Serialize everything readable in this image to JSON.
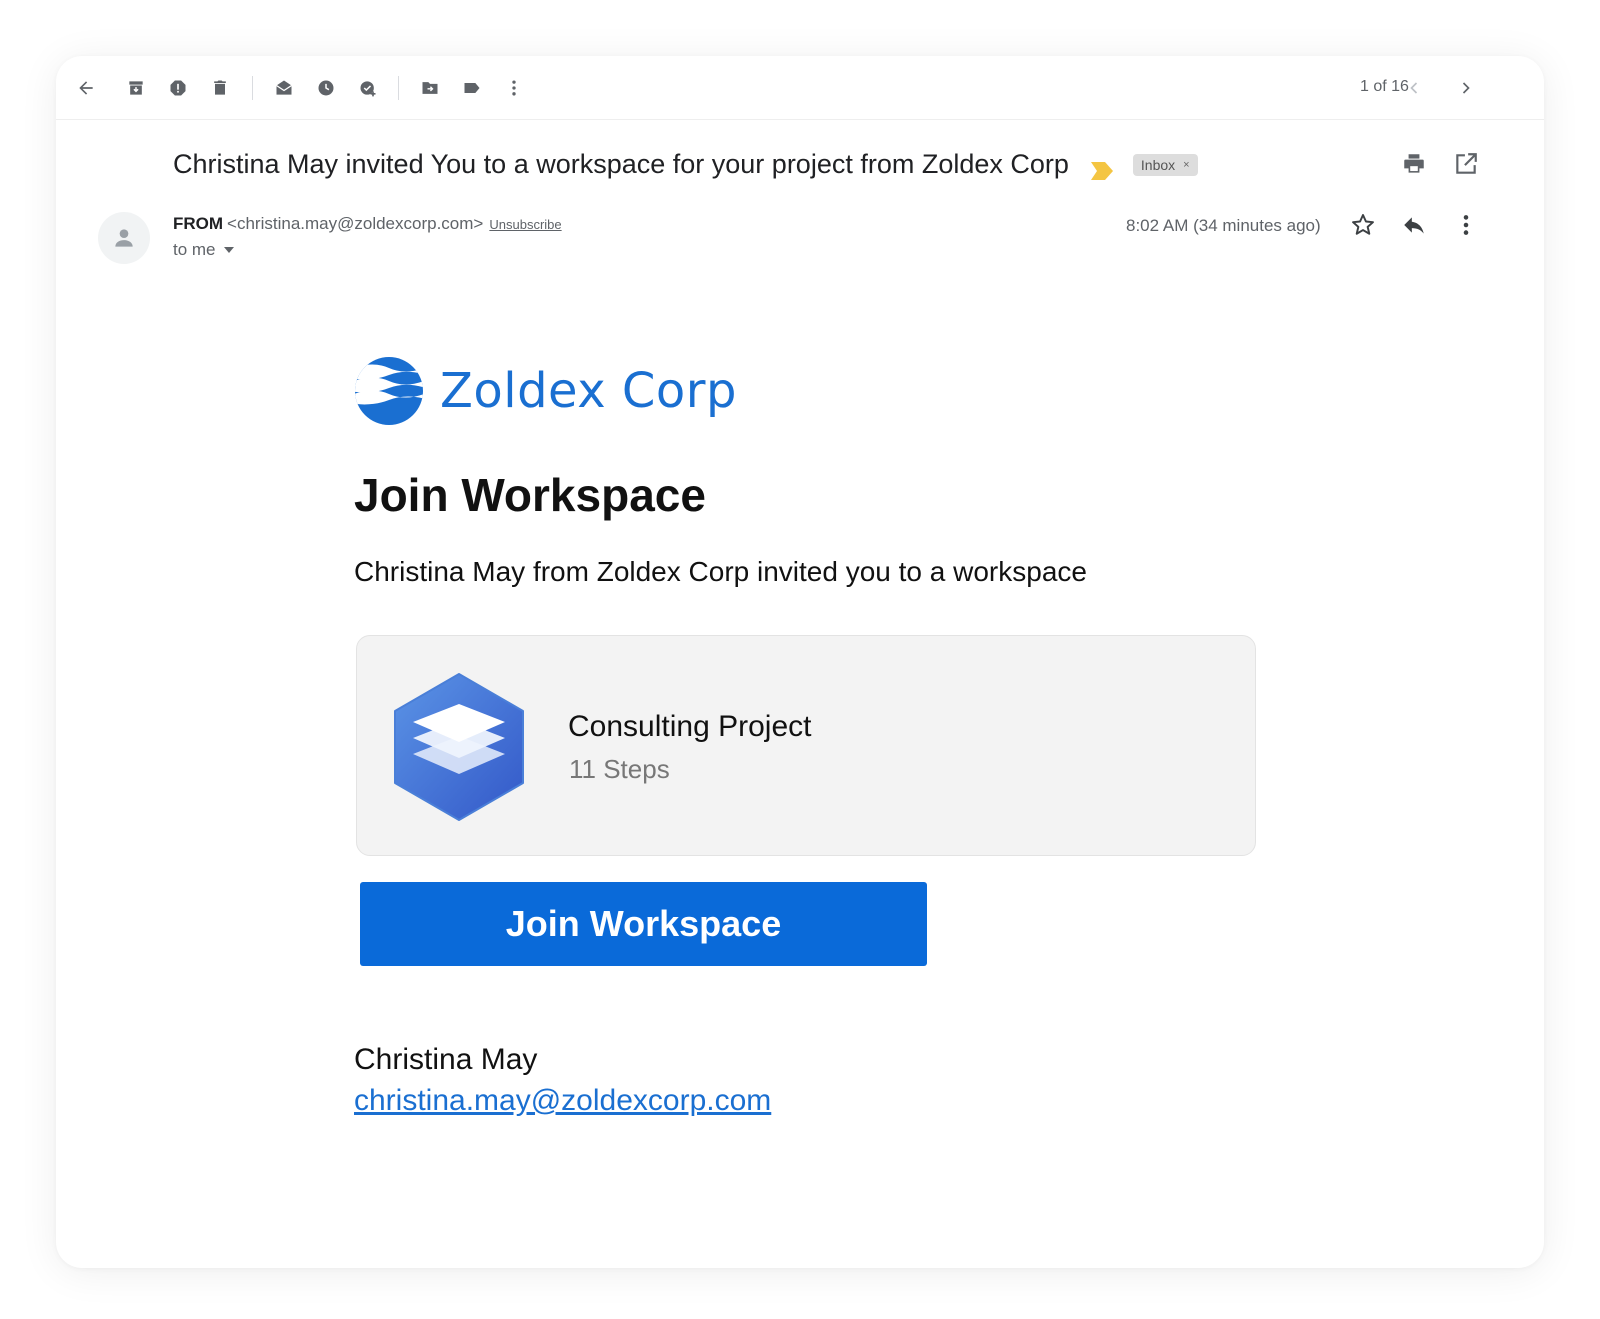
{
  "toolbar": {
    "icons": [
      "back-arrow-icon",
      "archive-icon",
      "report-spam-icon",
      "delete-icon",
      "mark-unread-icon",
      "snooze-icon",
      "add-task-icon",
      "move-to-icon",
      "label-icon",
      "more-vert-icon"
    ],
    "pager_text": "1 of 16"
  },
  "message": {
    "subject": "Christina May invited You to a workspace for your project from Zoldex Corp",
    "label_chip": "Inbox",
    "label_chip_close": "×",
    "sender_name": "FROM",
    "sender_email": "<christina.may@zoldexcorp.com>",
    "unsubscribe": "Unsubscribe",
    "to_me": "to me",
    "timestamp": "8:02 AM (34 minutes ago)"
  },
  "email_body": {
    "brand_name": "Zoldex Corp",
    "heading": "Join Workspace",
    "invite_text": "Christina May from Zoldex Corp invited you to a workspace",
    "project": {
      "title": "Consulting Project",
      "steps": "11 Steps"
    },
    "cta_label": "Join Workspace",
    "signature_name": "Christina May",
    "signature_email": "christina.may@zoldexcorp.com"
  },
  "colors": {
    "brand_blue": "#1a6fd1",
    "button_blue": "#0a6ad9",
    "importance_yellow": "#f4c542",
    "card_bg": "#f3f3f3"
  }
}
